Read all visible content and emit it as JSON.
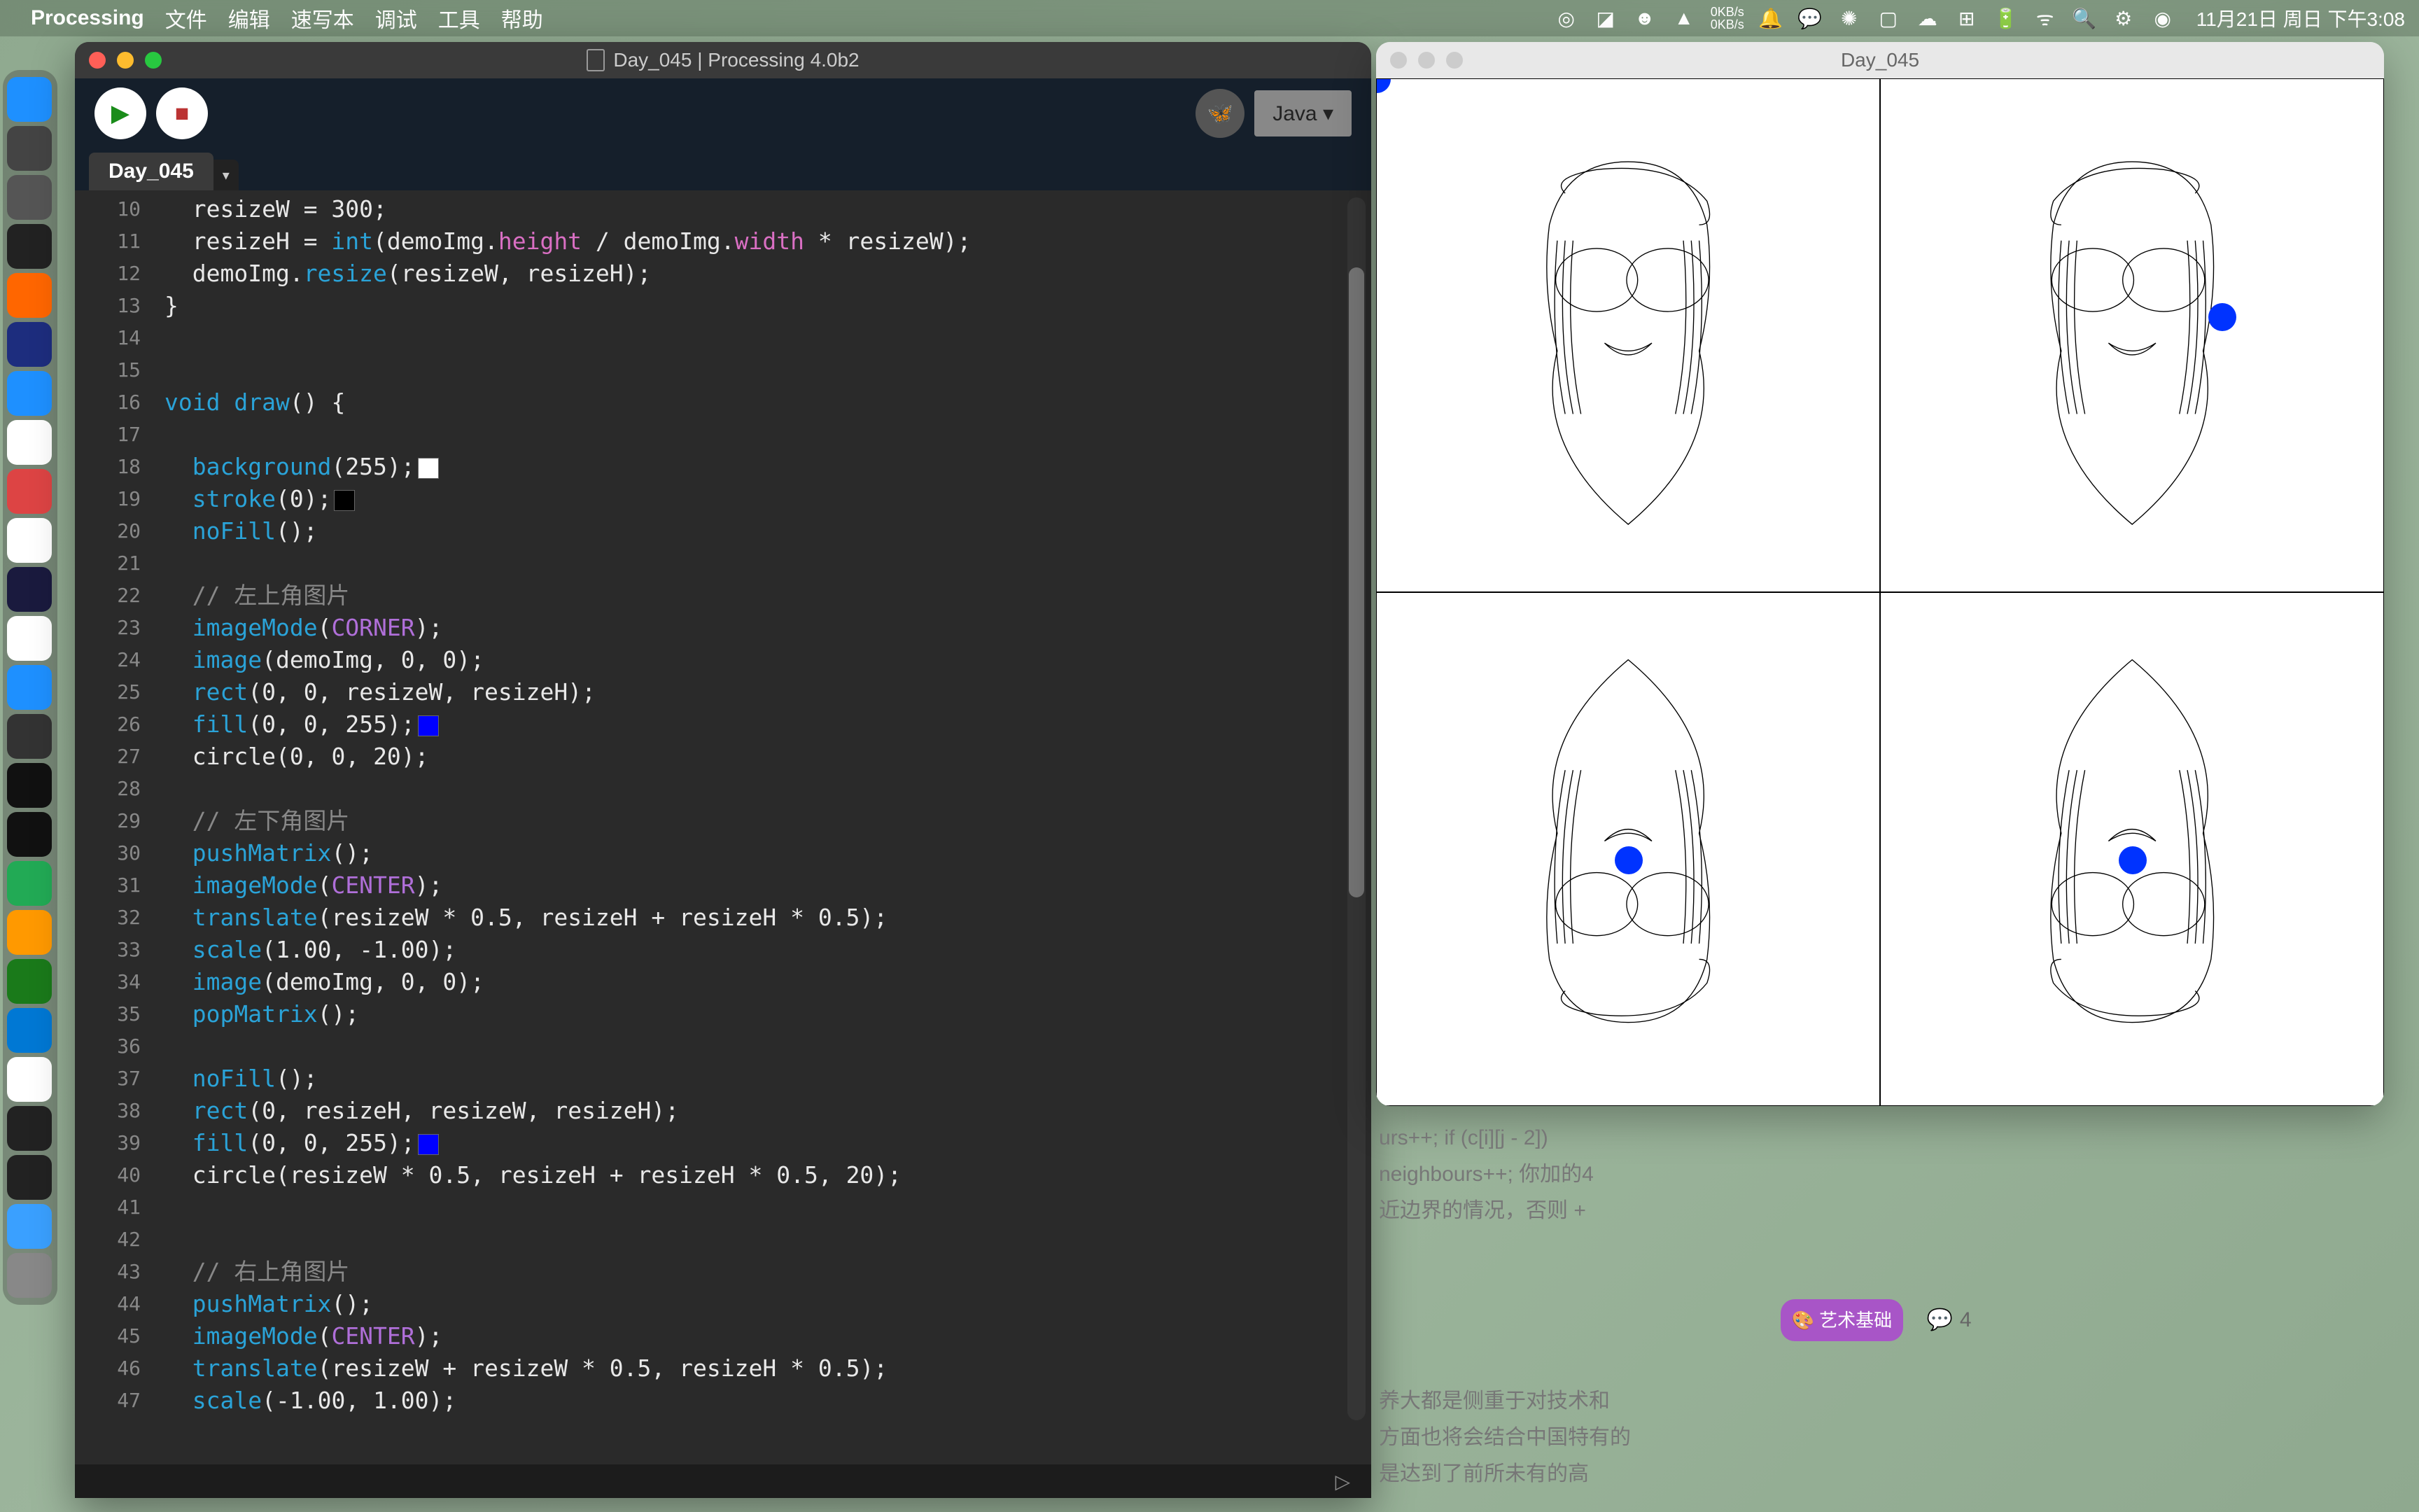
{
  "menubar": {
    "app_name": "Processing",
    "items": [
      "文件",
      "编辑",
      "速写本",
      "调试",
      "工具",
      "帮助"
    ],
    "net_up": "0KB/s",
    "net_down": "0KB/s",
    "clock": "11月21日 周日 下午3:08"
  },
  "ide": {
    "title": "Day_045 | Processing 4.0b2",
    "tab": "Day_045",
    "java_label": "Java ▾",
    "footer_arrow": "▷",
    "lines": [
      {
        "n": 10,
        "html": "  resizeW = <span class='num'>300</span>;"
      },
      {
        "n": 11,
        "html": "  resizeH = <span class='fn'>int</span>(demoImg.<span class='field'>height</span> / demoImg.<span class='field'>width</span> * resizeW);"
      },
      {
        "n": 12,
        "html": "  demoImg.<span class='fn'>resize</span>(resizeW, resizeH);"
      },
      {
        "n": 13,
        "html": "}"
      },
      {
        "n": 14,
        "html": ""
      },
      {
        "n": 15,
        "html": ""
      },
      {
        "n": 16,
        "html": "<span class='kw'>void</span> <span class='fn'>draw</span>() {"
      },
      {
        "n": 17,
        "html": ""
      },
      {
        "n": 18,
        "html": "  <span class='fn'>background</span>(<span class='num'>255</span>);<span class='swatch' style='background:#fff'></span>"
      },
      {
        "n": 19,
        "html": "  <span class='fn'>stroke</span>(<span class='num'>0</span>);<span class='swatch' style='background:#000'></span>"
      },
      {
        "n": 20,
        "html": "  <span class='fn'>noFill</span>();"
      },
      {
        "n": 21,
        "html": ""
      },
      {
        "n": 22,
        "html": "  <span class='comment'>// 左上角图片</span>"
      },
      {
        "n": 23,
        "html": "  <span class='fn'>imageMode</span>(<span class='const'>CORNER</span>);"
      },
      {
        "n": 24,
        "html": "  <span class='fn'>image</span>(demoImg, <span class='num'>0</span>, <span class='num'>0</span>);"
      },
      {
        "n": 25,
        "html": "  <span class='fn'>rect</span>(<span class='num'>0</span>, <span class='num'>0</span>, resizeW, resizeH);"
      },
      {
        "n": 26,
        "html": "  <span class='fn'>fill</span>(<span class='num'>0</span>, <span class='num'>0</span>, <span class='num'>255</span>);<span class='swatch' style='background:#0000ff'></span>"
      },
      {
        "n": 27,
        "html": "  circle(<span class='num'>0</span>, <span class='num'>0</span>, <span class='num'>20</span>);"
      },
      {
        "n": 28,
        "html": ""
      },
      {
        "n": 29,
        "html": "  <span class='comment'>// 左下角图片</span>"
      },
      {
        "n": 30,
        "html": "  <span class='fn'>pushMatrix</span>();"
      },
      {
        "n": 31,
        "html": "  <span class='fn'>imageMode</span>(<span class='const'>CENTER</span>);"
      },
      {
        "n": 32,
        "html": "  <span class='fn'>translate</span>(resizeW * <span class='num'>0.5</span>, resizeH + resizeH * <span class='num'>0.5</span>);"
      },
      {
        "n": 33,
        "html": "  <span class='fn'>scale</span>(<span class='num'>1.00</span>, <span class='num'>-1.00</span>);"
      },
      {
        "n": 34,
        "html": "  <span class='fn'>image</span>(demoImg, <span class='num'>0</span>, <span class='num'>0</span>);"
      },
      {
        "n": 35,
        "html": "  <span class='fn'>popMatrix</span>();"
      },
      {
        "n": 36,
        "html": ""
      },
      {
        "n": 37,
        "html": "  <span class='fn'>noFill</span>();"
      },
      {
        "n": 38,
        "html": "  <span class='fn'>rect</span>(<span class='num'>0</span>, resizeH, resizeW, resizeH);"
      },
      {
        "n": 39,
        "html": "  <span class='fn'>fill</span>(<span class='num'>0</span>, <span class='num'>0</span>, <span class='num'>255</span>);<span class='swatch' style='background:#0000ff'></span>"
      },
      {
        "n": 40,
        "html": "  circle(resizeW * <span class='num'>0.5</span>, resizeH + resizeH * <span class='num'>0.5</span>, <span class='num'>20</span>);"
      },
      {
        "n": 41,
        "html": ""
      },
      {
        "n": 42,
        "html": ""
      },
      {
        "n": 43,
        "html": "  <span class='comment'>// 右上角图片</span>"
      },
      {
        "n": 44,
        "html": "  <span class='fn'>pushMatrix</span>();"
      },
      {
        "n": 45,
        "html": "  <span class='fn'>imageMode</span>(<span class='const'>CENTER</span>);"
      },
      {
        "n": 46,
        "html": "  <span class='fn'>translate</span>(resizeW + resizeW * <span class='num'>0.5</span>, resizeH * <span class='num'>0.5</span>);"
      },
      {
        "n": 47,
        "html": "  <span class='fn'>scale</span>(<span class='num'>-1.00</span>, <span class='num'>1.00</span>);"
      }
    ]
  },
  "sketch": {
    "title": "Day_045"
  },
  "bg": {
    "line1": "urs++; if (c[i][j - 2])",
    "line2": "neighbours++; 你加的4",
    "line3": "近边界的情况，否则 +",
    "badge": "🎨 艺术基础",
    "comment_count": "4",
    "p1": "养大都是侧重于对技术和",
    "p2": "方面也将会结合中国特有的",
    "p3": "是达到了前所未有的高"
  },
  "dock_items": [
    {
      "name": "finder",
      "bg": "#1e90ff"
    },
    {
      "name": "launchpad",
      "bg": "#444"
    },
    {
      "name": "settings",
      "bg": "#555"
    },
    {
      "name": "processing",
      "bg": "#222"
    },
    {
      "name": "orange1",
      "bg": "#f60"
    },
    {
      "name": "an",
      "bg": "#1d2d7e"
    },
    {
      "name": "blue1",
      "bg": "#1e90ff"
    },
    {
      "name": "qq",
      "bg": "#fff"
    },
    {
      "name": "wps",
      "bg": "#d44"
    },
    {
      "name": "text",
      "bg": "#fff"
    },
    {
      "name": "ae",
      "bg": "#1a1a3e"
    },
    {
      "name": "chrome",
      "bg": "#fff"
    },
    {
      "name": "safari",
      "bg": "#1e90ff"
    },
    {
      "name": "grey",
      "bg": "#333"
    },
    {
      "name": "black",
      "bg": "#111"
    },
    {
      "name": "term",
      "bg": "#111"
    },
    {
      "name": "blue2",
      "bg": "#2a5"
    },
    {
      "name": "subl",
      "bg": "#f90"
    },
    {
      "name": "vim",
      "bg": "#1a7a1a"
    },
    {
      "name": "vscode",
      "bg": "#0078d4"
    },
    {
      "name": "note",
      "bg": "#fff"
    },
    {
      "name": "dark1",
      "bg": "#222"
    },
    {
      "name": "dark2",
      "bg": "#222"
    },
    {
      "name": "folder",
      "bg": "#3aa0ff"
    },
    {
      "name": "trash",
      "bg": "#888"
    }
  ]
}
